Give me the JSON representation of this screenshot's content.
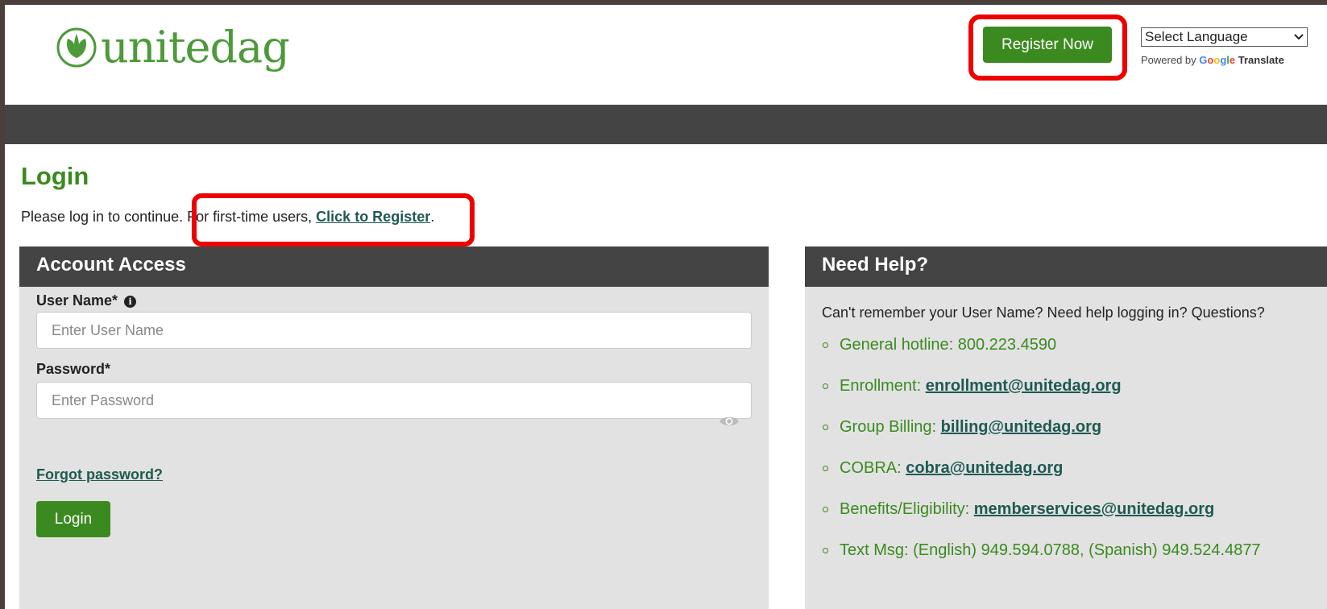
{
  "header": {
    "logo_text": "unitedag",
    "register_button": "Register Now",
    "language_select": "Select Language",
    "powered_by": "Powered by",
    "google": "Google",
    "translate": "Translate"
  },
  "login": {
    "title": "Login",
    "intro_text": "Please log in to continue. For first-time users,",
    "register_link": "Click to Register",
    "intro_end": "."
  },
  "account_access": {
    "title": "Account Access",
    "username_label": "User Name*",
    "username_placeholder": "Enter User Name",
    "password_label": "Password*",
    "password_placeholder": "Enter Password",
    "forgot_link": "Forgot password?",
    "login_button": "Login"
  },
  "help": {
    "title": "Need Help?",
    "intro": "Can't remember your User Name? Need help logging in? Questions?",
    "items": [
      {
        "label": "General hotline: 800.223.4590",
        "link": ""
      },
      {
        "label": "Enrollment: ",
        "link": "enrollment@unitedag.org"
      },
      {
        "label": "Group Billing: ",
        "link": "billing@unitedag.org"
      },
      {
        "label": "COBRA: ",
        "link": "cobra@unitedag.org"
      },
      {
        "label": "Benefits/Eligibility: ",
        "link": "memberservices@unitedag.org"
      },
      {
        "label": "Text Msg: (English) 949.594.0788, (Spanish) 949.524.4877",
        "link": ""
      }
    ]
  },
  "colors": {
    "brand_green": "#3b8a1f",
    "nav_dark": "#444444",
    "highlight_red": "#ee0000"
  }
}
